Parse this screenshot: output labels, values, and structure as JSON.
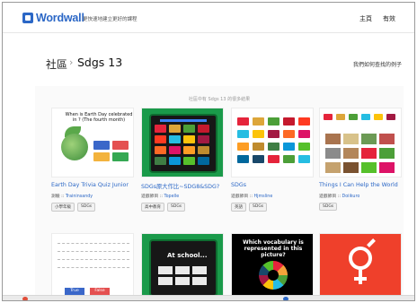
{
  "header": {
    "logo_text": "Wordwall",
    "tagline": "更快速地建立更好的課程",
    "nav_main": "主頁",
    "nav_lang": "有效"
  },
  "title_bar": {
    "crumb_root": "社區",
    "crumb_sep": "›",
    "page_title": "Sdgs 13",
    "right_link": "我們如何查找的例子"
  },
  "notice": "社區中有 Sdgs 13 的很多結果",
  "cards": [
    {
      "title": "Earth Day Trivia Quiz Junior",
      "thumb_text": "When is Earth Day celebrated in ? (The fourth month)",
      "type": "測驗",
      "author": "Traininsandy",
      "tags": [
        "小學年級",
        "SDGs"
      ]
    },
    {
      "title": "SDGs原大作比~SDG8&SDG?",
      "type": "遊戲節目",
      "author": "Topelle",
      "tags": [
        "高中教育",
        "SDGs"
      ]
    },
    {
      "title": "SDGs",
      "type": "遊戲節目",
      "author": "Hjmsline",
      "tags": [
        "英語",
        "SDGs"
      ]
    },
    {
      "title": "Things I Can Help the World",
      "type": "遊戲節目",
      "author": "Doiikuro",
      "tags": [
        "SDGs"
      ]
    }
  ],
  "row2": [
    {
      "true_label": "True",
      "false_label": "False"
    },
    {
      "text": "At school..."
    },
    {
      "text": "Which vocabulary is represented in this picture?"
    },
    {}
  ],
  "colors": {
    "brand": "#2b67c6",
    "sdg_green": "#1a9a4a",
    "sdg_red": "#ef402b"
  }
}
